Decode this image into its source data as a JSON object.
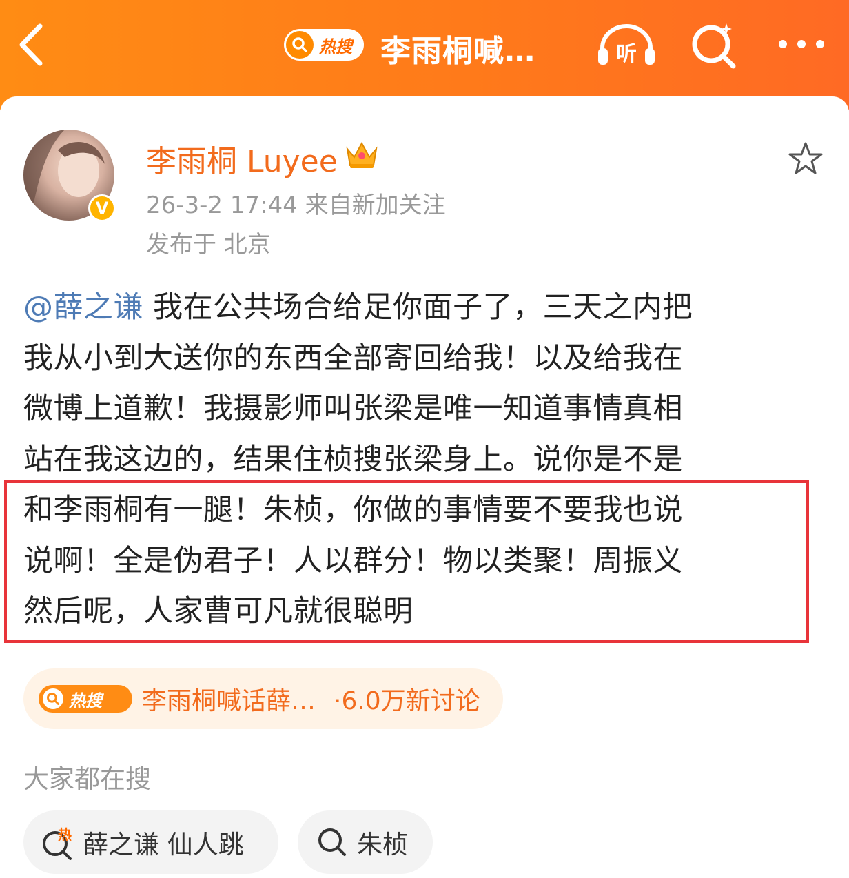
{
  "header": {
    "hot_badge": "热搜",
    "title": "李雨桐喊…",
    "listen_label": "听"
  },
  "post": {
    "author": "李雨桐 Luyee",
    "verified_mark": "V",
    "time_source": "26-3-2 17:44  来自新加关注",
    "location": "发布于 北京",
    "mention": "@薛之谦",
    "lines": [
      " 我在公共场合给足你面子了，三天之内把",
      "我从小到大送你的东西全部寄回给我！以及给我在",
      "微博上道歉！我摄影师叫张梁是唯一知道事情真相",
      "站在我这边的，结果住桢搜张梁身上。说你是不是",
      "和李雨桐有一腿！朱桢，你做的事情要不要我也说",
      "说啊！全是伪君子！人以群分！物以类聚！周振义",
      "然后呢，人家曹可凡就很聪明"
    ]
  },
  "topic": {
    "badge": "热搜",
    "title": "李雨桐喊话薛…",
    "count": "·6.0万新讨论"
  },
  "related": {
    "section_title": "大家都在搜",
    "chips": [
      {
        "label": "薛之谦 仙人跳",
        "icon_badge": "热"
      },
      {
        "label": "朱桢"
      }
    ]
  },
  "colors": {
    "brand_orange": "#ff7a1a",
    "author_orange": "#f26b1d",
    "mention_blue": "#4e7bb5",
    "highlight_red": "#e8343a"
  }
}
